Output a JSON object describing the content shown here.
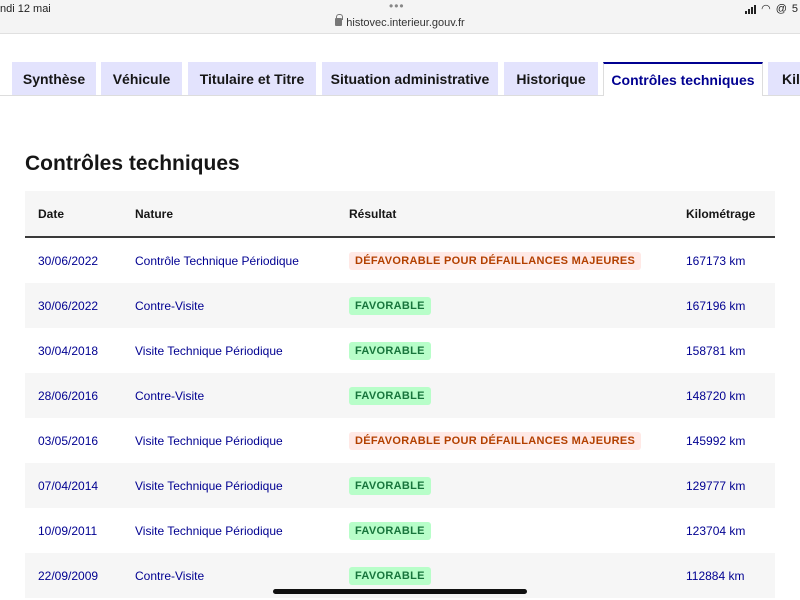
{
  "status_bar": {
    "date": "ndi 12 mai",
    "dots": "•••",
    "url": "histovec.interieur.gouv.fr",
    "battery_text": "5"
  },
  "tabs": [
    {
      "label": "Synthèse",
      "active": false
    },
    {
      "label": "Véhicule",
      "active": false
    },
    {
      "label": "Titulaire et Titre",
      "active": false
    },
    {
      "label": "Situation administrative",
      "active": false
    },
    {
      "label": "Historique",
      "active": false
    },
    {
      "label": "Contrôles techniques",
      "active": true
    },
    {
      "label": "Kilo",
      "active": false
    }
  ],
  "section": {
    "title": "Contrôles techniques"
  },
  "table": {
    "headers": {
      "date": "Date",
      "nature": "Nature",
      "result": "Résultat",
      "km": "Kilométrage"
    },
    "rows": [
      {
        "date": "30/06/2022",
        "nature": "Contrôle Technique Périodique",
        "result": "DÉFAVORABLE POUR DÉFAILLANCES MAJEURES",
        "status": "ko",
        "km": "167173 km"
      },
      {
        "date": "30/06/2022",
        "nature": "Contre-Visite",
        "result": "FAVORABLE",
        "status": "ok",
        "km": "167196 km"
      },
      {
        "date": "30/04/2018",
        "nature": "Visite Technique Périodique",
        "result": "FAVORABLE",
        "status": "ok",
        "km": "158781 km"
      },
      {
        "date": "28/06/2016",
        "nature": "Contre-Visite",
        "result": "FAVORABLE",
        "status": "ok",
        "km": "148720 km"
      },
      {
        "date": "03/05/2016",
        "nature": "Visite Technique Périodique",
        "result": "DÉFAVORABLE POUR DÉFAILLANCES MAJEURES",
        "status": "ko",
        "km": "145992 km"
      },
      {
        "date": "07/04/2014",
        "nature": "Visite Technique Périodique",
        "result": "FAVORABLE",
        "status": "ok",
        "km": "129777 km"
      },
      {
        "date": "10/09/2011",
        "nature": "Visite Technique Périodique",
        "result": "FAVORABLE",
        "status": "ok",
        "km": "123704 km"
      },
      {
        "date": "22/09/2009",
        "nature": "Contre-Visite",
        "result": "FAVORABLE",
        "status": "ok",
        "km": "112884 km"
      }
    ]
  },
  "colors": {
    "accent": "#000091",
    "tab_bg": "#e3e3fd",
    "favorable_bg": "#b8fec9",
    "favorable_text": "#18753c",
    "defavorable_bg": "#ffe9e6",
    "defavorable_text": "#b34000"
  },
  "icons": {
    "lock": "lock-icon",
    "signal": "signal-icon",
    "wifi": "wifi-icon",
    "at": "at-icon"
  }
}
